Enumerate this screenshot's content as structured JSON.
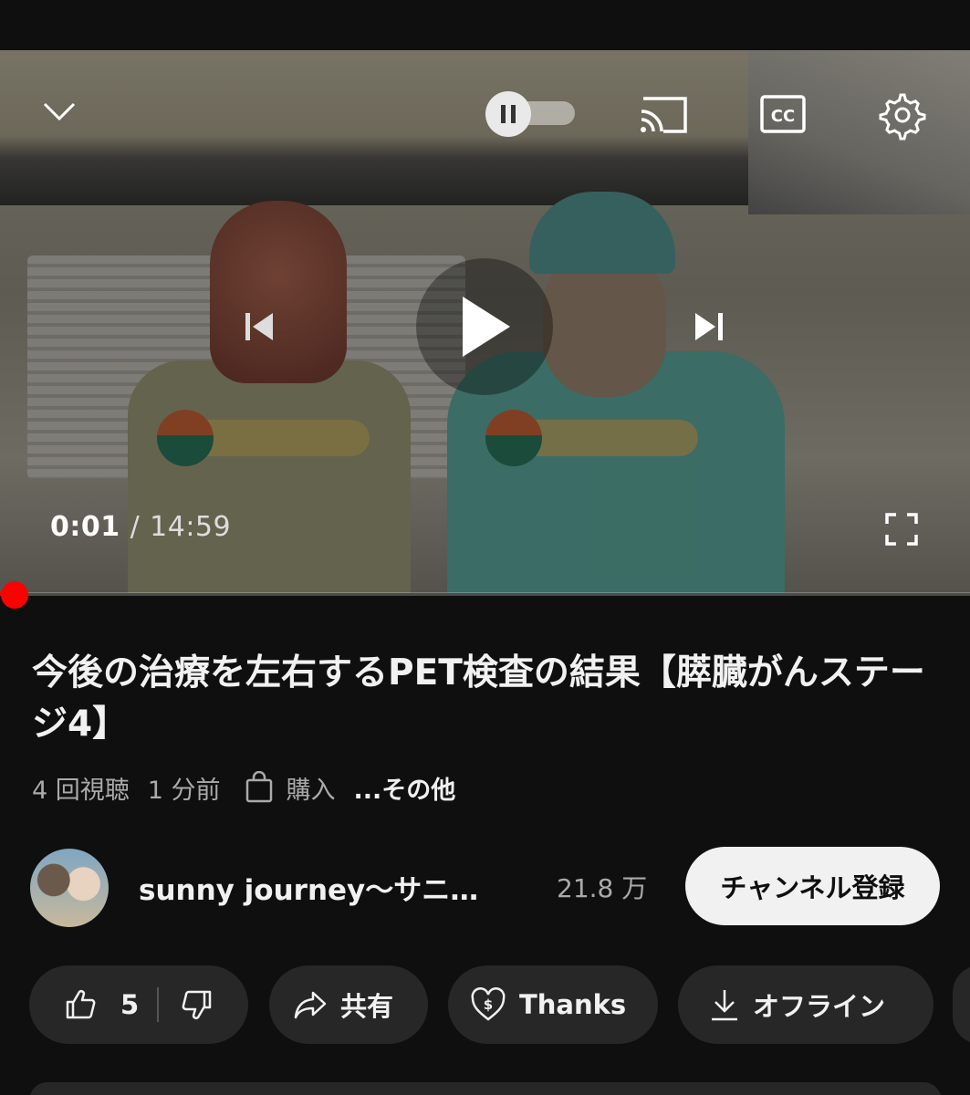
{
  "player": {
    "current_time": "0:01",
    "separator": "/",
    "duration": "14:59",
    "progress_fraction": 0.001,
    "collapse_icon": "chevron-down-icon",
    "autoplay_icon": "pause-icon",
    "cast_icon": "cast-icon",
    "cc_icon": "closed-captions-icon",
    "settings_icon": "gear-icon",
    "prev_icon": "skip-previous-icon",
    "play_icon": "play-icon",
    "next_icon": "skip-next-icon",
    "fullscreen_icon": "fullscreen-icon",
    "progress_color": "#ff0000"
  },
  "video": {
    "title": "今後の治療を左右するPET検査の結果【膵臓がんステージ4】",
    "views": "4 回視聴",
    "age": "1 分前",
    "shop_icon": "shopping-bag-icon",
    "purchase_label": "購入",
    "more_label": "...その他"
  },
  "channel": {
    "name": "sunny journey～サニ…",
    "subscribers": "21.8 万",
    "subscribe_label": "チャンネル登録"
  },
  "actions": {
    "like_count": "5",
    "share_label": "共有",
    "thanks_label": "Thanks",
    "offline_label": "オフライン",
    "like_icon": "thumbs-up-icon",
    "dislike_icon": "thumbs-down-icon",
    "share_icon": "share-icon",
    "thanks_icon": "heart-dollar-icon",
    "offline_icon": "download-icon"
  },
  "theme": {
    "background": "#0f0f0f",
    "pill": "#272727",
    "text": "#f1f1f1",
    "secondary_text": "#aaaaaa"
  }
}
